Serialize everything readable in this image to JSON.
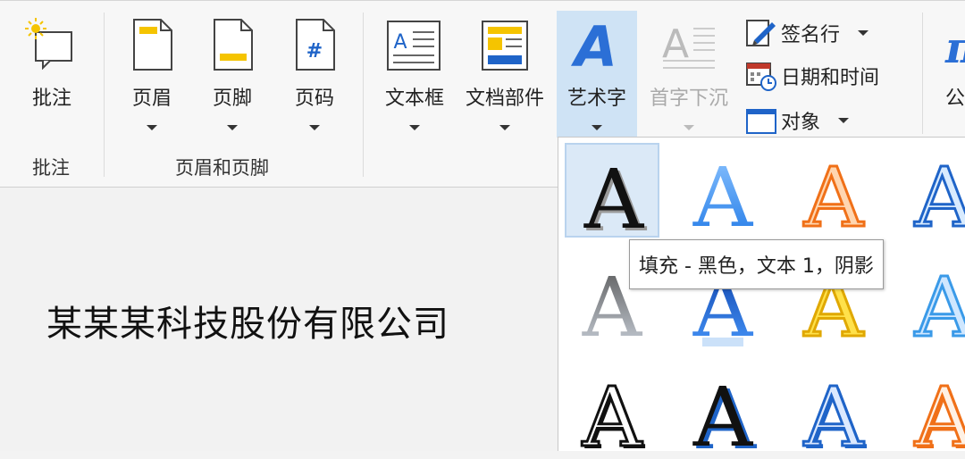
{
  "ribbon": {
    "comment_btn": "批注",
    "comment_group": "批注",
    "header_btn": "页眉",
    "footer_btn": "页脚",
    "pagenum_btn": "页码",
    "hf_group": "页眉和页脚",
    "textbox_btn": "文本框",
    "docparts_btn": "文档部件",
    "wordart_btn": "艺术字",
    "dropcap_btn": "首字下沉",
    "signature_btn": "签名行",
    "datetime_btn": "日期和时间",
    "object_btn": "对象",
    "partial_btn": "公"
  },
  "document": {
    "text": "某某某科技股份有限公司"
  },
  "gallery": {
    "glyph": "A",
    "tooltip": "填充 - 黑色，文本 1，阴影"
  },
  "colors": {
    "accent": "#2b6fd6",
    "active_bg": "#cfe3f5",
    "gallery_hover": "#dbe9f7"
  }
}
